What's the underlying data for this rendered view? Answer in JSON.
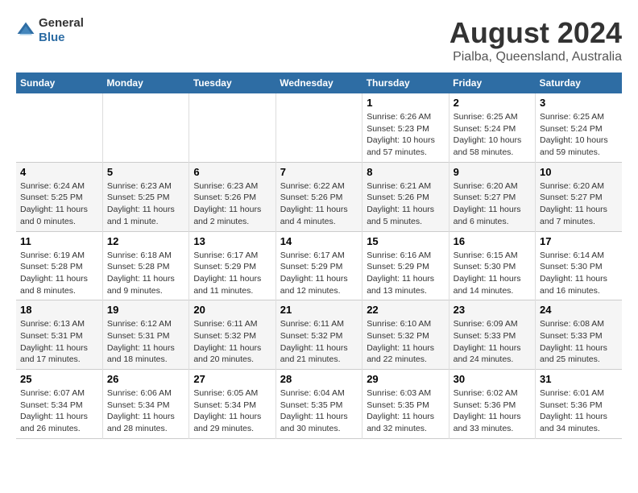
{
  "logo": {
    "general": "General",
    "blue": "Blue"
  },
  "title": "August 2024",
  "subtitle": "Pialba, Queensland, Australia",
  "headers": [
    "Sunday",
    "Monday",
    "Tuesday",
    "Wednesday",
    "Thursday",
    "Friday",
    "Saturday"
  ],
  "weeks": [
    [
      {
        "day": "",
        "info": ""
      },
      {
        "day": "",
        "info": ""
      },
      {
        "day": "",
        "info": ""
      },
      {
        "day": "",
        "info": ""
      },
      {
        "day": "1",
        "info": "Sunrise: 6:26 AM\nSunset: 5:23 PM\nDaylight: 10 hours and 57 minutes."
      },
      {
        "day": "2",
        "info": "Sunrise: 6:25 AM\nSunset: 5:24 PM\nDaylight: 10 hours and 58 minutes."
      },
      {
        "day": "3",
        "info": "Sunrise: 6:25 AM\nSunset: 5:24 PM\nDaylight: 10 hours and 59 minutes."
      }
    ],
    [
      {
        "day": "4",
        "info": "Sunrise: 6:24 AM\nSunset: 5:25 PM\nDaylight: 11 hours and 0 minutes."
      },
      {
        "day": "5",
        "info": "Sunrise: 6:23 AM\nSunset: 5:25 PM\nDaylight: 11 hours and 1 minute."
      },
      {
        "day": "6",
        "info": "Sunrise: 6:23 AM\nSunset: 5:26 PM\nDaylight: 11 hours and 2 minutes."
      },
      {
        "day": "7",
        "info": "Sunrise: 6:22 AM\nSunset: 5:26 PM\nDaylight: 11 hours and 4 minutes."
      },
      {
        "day": "8",
        "info": "Sunrise: 6:21 AM\nSunset: 5:26 PM\nDaylight: 11 hours and 5 minutes."
      },
      {
        "day": "9",
        "info": "Sunrise: 6:20 AM\nSunset: 5:27 PM\nDaylight: 11 hours and 6 minutes."
      },
      {
        "day": "10",
        "info": "Sunrise: 6:20 AM\nSunset: 5:27 PM\nDaylight: 11 hours and 7 minutes."
      }
    ],
    [
      {
        "day": "11",
        "info": "Sunrise: 6:19 AM\nSunset: 5:28 PM\nDaylight: 11 hours and 8 minutes."
      },
      {
        "day": "12",
        "info": "Sunrise: 6:18 AM\nSunset: 5:28 PM\nDaylight: 11 hours and 9 minutes."
      },
      {
        "day": "13",
        "info": "Sunrise: 6:17 AM\nSunset: 5:29 PM\nDaylight: 11 hours and 11 minutes."
      },
      {
        "day": "14",
        "info": "Sunrise: 6:17 AM\nSunset: 5:29 PM\nDaylight: 11 hours and 12 minutes."
      },
      {
        "day": "15",
        "info": "Sunrise: 6:16 AM\nSunset: 5:29 PM\nDaylight: 11 hours and 13 minutes."
      },
      {
        "day": "16",
        "info": "Sunrise: 6:15 AM\nSunset: 5:30 PM\nDaylight: 11 hours and 14 minutes."
      },
      {
        "day": "17",
        "info": "Sunrise: 6:14 AM\nSunset: 5:30 PM\nDaylight: 11 hours and 16 minutes."
      }
    ],
    [
      {
        "day": "18",
        "info": "Sunrise: 6:13 AM\nSunset: 5:31 PM\nDaylight: 11 hours and 17 minutes."
      },
      {
        "day": "19",
        "info": "Sunrise: 6:12 AM\nSunset: 5:31 PM\nDaylight: 11 hours and 18 minutes."
      },
      {
        "day": "20",
        "info": "Sunrise: 6:11 AM\nSunset: 5:32 PM\nDaylight: 11 hours and 20 minutes."
      },
      {
        "day": "21",
        "info": "Sunrise: 6:11 AM\nSunset: 5:32 PM\nDaylight: 11 hours and 21 minutes."
      },
      {
        "day": "22",
        "info": "Sunrise: 6:10 AM\nSunset: 5:32 PM\nDaylight: 11 hours and 22 minutes."
      },
      {
        "day": "23",
        "info": "Sunrise: 6:09 AM\nSunset: 5:33 PM\nDaylight: 11 hours and 24 minutes."
      },
      {
        "day": "24",
        "info": "Sunrise: 6:08 AM\nSunset: 5:33 PM\nDaylight: 11 hours and 25 minutes."
      }
    ],
    [
      {
        "day": "25",
        "info": "Sunrise: 6:07 AM\nSunset: 5:34 PM\nDaylight: 11 hours and 26 minutes."
      },
      {
        "day": "26",
        "info": "Sunrise: 6:06 AM\nSunset: 5:34 PM\nDaylight: 11 hours and 28 minutes."
      },
      {
        "day": "27",
        "info": "Sunrise: 6:05 AM\nSunset: 5:34 PM\nDaylight: 11 hours and 29 minutes."
      },
      {
        "day": "28",
        "info": "Sunrise: 6:04 AM\nSunset: 5:35 PM\nDaylight: 11 hours and 30 minutes."
      },
      {
        "day": "29",
        "info": "Sunrise: 6:03 AM\nSunset: 5:35 PM\nDaylight: 11 hours and 32 minutes."
      },
      {
        "day": "30",
        "info": "Sunrise: 6:02 AM\nSunset: 5:36 PM\nDaylight: 11 hours and 33 minutes."
      },
      {
        "day": "31",
        "info": "Sunrise: 6:01 AM\nSunset: 5:36 PM\nDaylight: 11 hours and 34 minutes."
      }
    ]
  ]
}
